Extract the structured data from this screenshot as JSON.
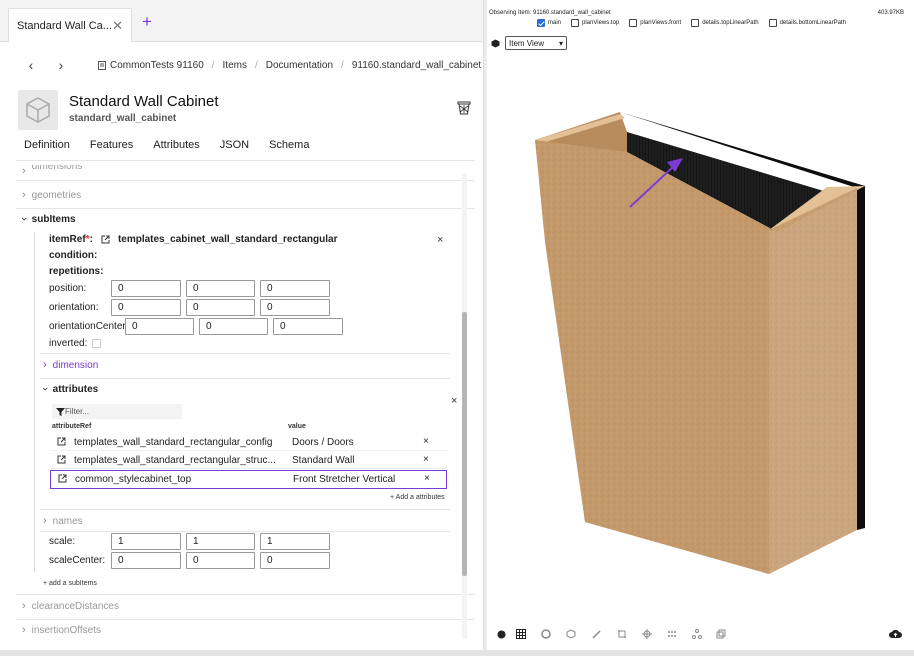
{
  "tab": {
    "title": "Standard Wall Ca...",
    "close_icon": "close-icon",
    "add_icon": "plus-icon"
  },
  "breadcrumb": {
    "home": "CommonTests 91160",
    "items": [
      "Items",
      "Documentation",
      "91160.standard_wall_cabinet"
    ]
  },
  "header": {
    "title": "Standard Wall Cabinet",
    "subtitle": "standard_wall_cabinet"
  },
  "main_tabs": [
    "Definition",
    "Features",
    "Attributes",
    "JSON",
    "Schema"
  ],
  "sections": {
    "dimensions": "dimensions",
    "geometries": "geometries",
    "subItems": "subItems",
    "clearanceDistances": "clearanceDistances",
    "insertionOffsets": "insertionOffsets",
    "add_subitems": "+ add a subItems"
  },
  "subitem": {
    "itemRef_label": "itemRef",
    "itemRef_required": "*",
    "itemRef_colon": ":",
    "itemRef_value": "templates_cabinet_wall_standard_rectangular",
    "condition_label": "condition:",
    "repetitions_label": "repetitions:",
    "position_label": "position:",
    "position": [
      "0",
      "0",
      "0"
    ],
    "orientation_label": "orientation:",
    "orientation": [
      "0",
      "0",
      "0"
    ],
    "orientationCenter_label": "orientationCenter",
    "orientationCenter": [
      "0",
      "0",
      "0"
    ],
    "inverted_label": "inverted:",
    "dimension_label": "dimension",
    "attributes_label": "attributes",
    "names_label": "names",
    "scale_label": "scale:",
    "scale": [
      "1",
      "1",
      "1"
    ],
    "scaleCenter_label": "scaleCenter:",
    "scaleCenter": [
      "0",
      "0",
      "0"
    ]
  },
  "attributes": {
    "filter_placeholder": "Filter...",
    "col_ref": "attributeRef",
    "col_value": "value",
    "rows": [
      {
        "ref": "templates_wall_standard_rectangular_config",
        "value": "Doors / Doors"
      },
      {
        "ref": "templates_wall_standard_rectangular_struc...",
        "value": "Standard Wall"
      },
      {
        "ref": "common_stylecabinet_top",
        "value": "Front Stretcher Vertical"
      }
    ],
    "add_link": "+ Add a attributes"
  },
  "viewer": {
    "observing": "Observing Item: 91160.standard_wall_cabinet",
    "size": "403.97KB",
    "checks": [
      {
        "label": "main",
        "checked": true
      },
      {
        "label": "planViews.top",
        "checked": false
      },
      {
        "label": "planViews.front",
        "checked": false
      },
      {
        "label": "details.topLinearPath",
        "checked": false
      },
      {
        "label": "details.bottomLinearPath",
        "checked": false
      }
    ],
    "view_select": "Item View",
    "accent": "#7b3bd4",
    "wood": "#c49a6c"
  }
}
